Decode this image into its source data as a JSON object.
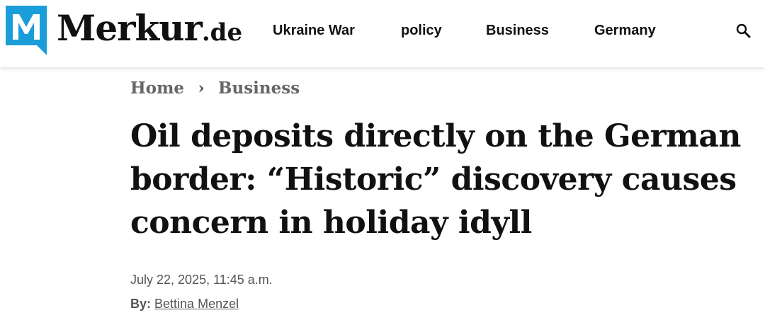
{
  "header": {
    "logo": {
      "name": "Merkur",
      "tld": ".de",
      "brand_color": "#1a9ed9"
    },
    "nav": [
      "Ukraine War",
      "policy",
      "Business",
      "Germany"
    ],
    "search_icon": "search-icon"
  },
  "breadcrumb": {
    "home": "Home",
    "separator": "›",
    "section": "Business"
  },
  "article": {
    "headline": "Oil deposits directly on the German border: “Historic” discovery causes concern in holiday idyll",
    "date": "July 22, 2025, 11:45 a.m.",
    "byline_label": "By:",
    "author": "Bettina Menzel"
  }
}
